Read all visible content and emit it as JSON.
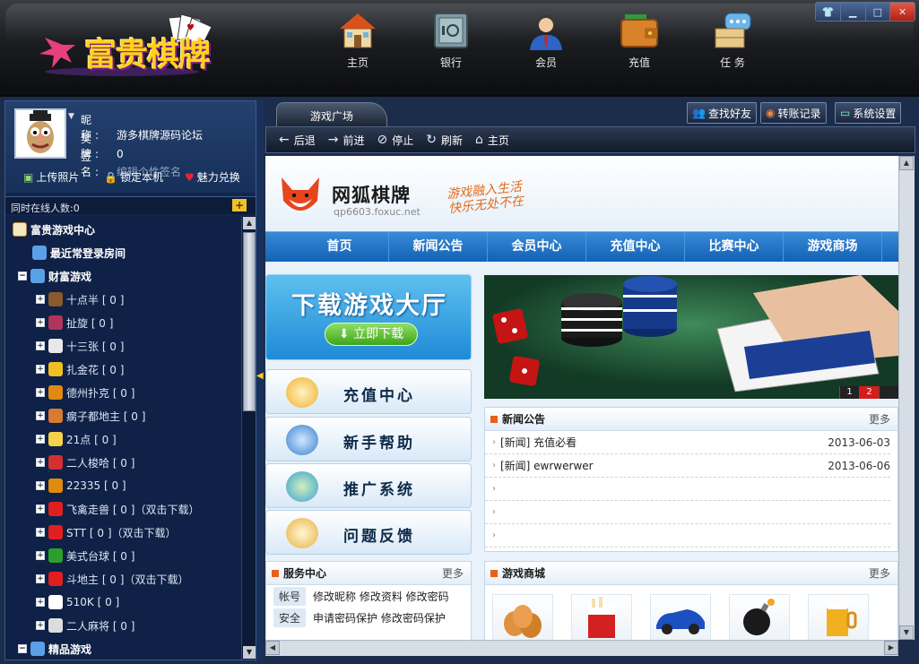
{
  "window": {
    "controls": [
      "skin",
      "min",
      "max",
      "close"
    ]
  },
  "app": {
    "logo_text": "富贵棋牌"
  },
  "topnav": [
    {
      "label": "主页",
      "icon": "house-icon"
    },
    {
      "label": "银行",
      "icon": "safe-icon"
    },
    {
      "label": "会员",
      "icon": "member-icon"
    },
    {
      "label": "充值",
      "icon": "wallet-icon"
    },
    {
      "label": "任 务",
      "icon": "chat-bubble-icon"
    }
  ],
  "profile": {
    "nick_label": "昵 称:",
    "nick": "游多棋牌源码论坛",
    "medal_label": "奖 牌:",
    "medal": "0",
    "sign_label": "签 名:",
    "sign": "编辑个性签名",
    "actions": [
      "上传照片",
      "锁定本机",
      "魅力兑换"
    ]
  },
  "online": {
    "label": "同时在线人数:0"
  },
  "tree": {
    "root": "富贵游戏中心",
    "recent": "最近常登录房间",
    "group1": "财富游戏",
    "games": [
      {
        "name": "十点半 [ 0 ]",
        "color": "#8a5a2a"
      },
      {
        "name": "扯旋 [ 0 ]",
        "color": "#b0355a"
      },
      {
        "name": "十三张 [ 0 ]",
        "color": "#e8e8e8"
      },
      {
        "name": "扎金花 [ 0 ]",
        "color": "#f0c020"
      },
      {
        "name": "德州扑克 [ 0 ]",
        "color": "#e08a10"
      },
      {
        "name": "瘸子都地主 [ 0 ]",
        "color": "#d87a30"
      },
      {
        "name": "21点 [ 0 ]",
        "color": "#f5d24a"
      },
      {
        "name": "二人梭哈 [ 0 ]",
        "color": "#d43030"
      },
      {
        "name": "22335 [ 0 ]",
        "color": "#e08a10"
      },
      {
        "name": "飞禽走兽 [ 0 ]（双击下载）",
        "color": "#e02020"
      },
      {
        "name": "STT [ 0 ]（双击下载）",
        "color": "#e02020"
      },
      {
        "name": "美式台球 [ 0 ]",
        "color": "#2aa02a"
      },
      {
        "name": "斗地主 [ 0 ]（双击下载）",
        "color": "#e02020"
      },
      {
        "name": "510K [ 0 ]",
        "color": "#ffffff"
      },
      {
        "name": "二人麻将 [ 0 ]",
        "color": "#dddddd"
      }
    ],
    "group2": "精品游戏"
  },
  "tabs": {
    "plaza": "游戏广场"
  },
  "toolbar": {
    "find_friend": "查找好友",
    "transfer": "转账记录",
    "settings": "系统设置"
  },
  "browser": {
    "back": "后退",
    "forward": "前进",
    "stop": "停止",
    "refresh": "刷新",
    "home": "主页"
  },
  "site": {
    "title": "网狐棋牌",
    "url": "qp6603.foxuc.net",
    "slogan1": "游戏融入生活",
    "slogan2": "快乐无处不在",
    "nav": [
      "首页",
      "新闻公告",
      "会员中心",
      "充值中心",
      "比赛中心",
      "游戏商场"
    ],
    "download_title": "下载游戏大厅",
    "download_button": "立即下载",
    "menu": [
      "充值中心",
      "新手帮助",
      "推广系统",
      "问题反馈"
    ],
    "service": {
      "title": "服务中心",
      "more": "更多",
      "rows": [
        {
          "tag": "帐号",
          "links": "修改昵称  修改资料  修改密码"
        },
        {
          "tag": "安全",
          "links": "申请密码保护  修改密码保护"
        }
      ]
    },
    "banner_pages": [
      "1",
      "2"
    ],
    "news": {
      "title": "新闻公告",
      "more": "更多",
      "items": [
        {
          "text": "[新闻] 充值必看",
          "date": "2013-06-03"
        },
        {
          "text": "[新闻] ewrwerwer",
          "date": "2013-06-06"
        },
        {
          "text": "",
          "date": ""
        },
        {
          "text": "",
          "date": ""
        },
        {
          "text": "",
          "date": ""
        }
      ]
    },
    "shop": {
      "title": "游戏商城",
      "more": "更多",
      "items": [
        "eggs",
        "cigarettes",
        "car",
        "bomb",
        "beer"
      ]
    }
  }
}
